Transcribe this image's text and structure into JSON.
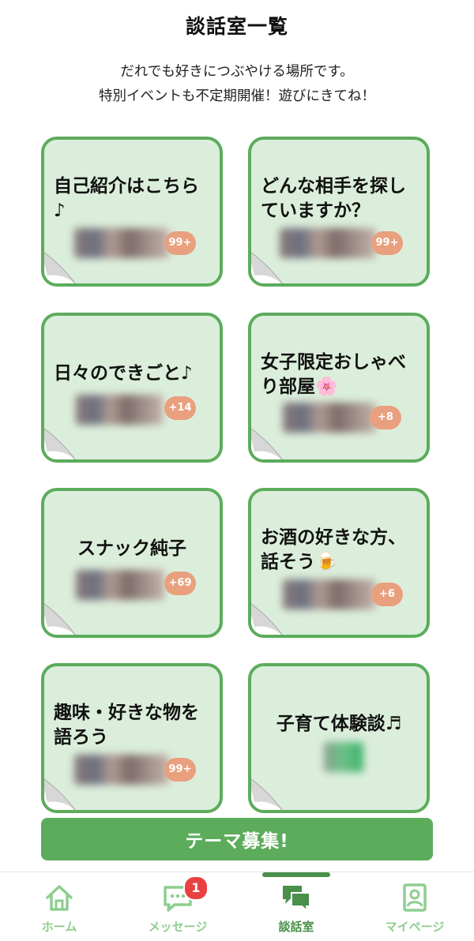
{
  "header": {
    "title": "談話室一覧"
  },
  "intro": {
    "line1": "だれでも好きにつぶやける場所です。",
    "line2": "特別イベントも不定期開催！遊びにきてね！"
  },
  "rooms": [
    {
      "title": "自己紹介はこちら\n♪",
      "count": "99+"
    },
    {
      "title": "どんな相手を探し\nていますか？",
      "count": "99+"
    },
    {
      "title": "日々のできごと♪",
      "count": "+14"
    },
    {
      "title": "女子限定おしゃべ\nり部屋🌸",
      "count": "+8"
    },
    {
      "title": "スナック純子",
      "count": "+69"
    },
    {
      "title": "お酒の好きな方、\n話そう🍺",
      "count": "+6"
    },
    {
      "title": "趣味・好きな物を\n語ろう",
      "count": "99+"
    },
    {
      "title": "子育て体験談♬",
      "count": ""
    }
  ],
  "theme_button": {
    "label": "テーマ募集!"
  },
  "tabbar": {
    "active": "談話室",
    "tabs": [
      {
        "label": "ホーム",
        "icon": "home-icon"
      },
      {
        "label": "メッセージ",
        "icon": "chat-icon",
        "badge": "1"
      },
      {
        "label": "談話室",
        "icon": "chatroom-icon"
      },
      {
        "label": "マイページ",
        "icon": "profile-icon"
      }
    ]
  },
  "colors": {
    "accent": "#5cac5c",
    "card_bg": "#dbeedb",
    "badge": "#e9a07f",
    "tab_active": "#4a8f4a",
    "tab_inactive": "#8fcd8f",
    "notification": "#e94141"
  }
}
